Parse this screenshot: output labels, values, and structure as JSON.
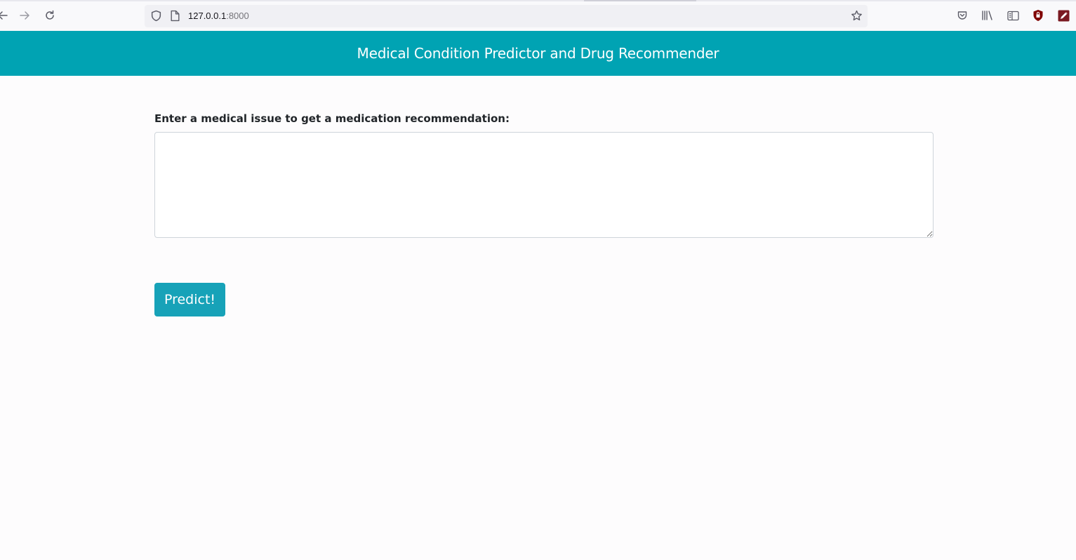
{
  "browser": {
    "url_host": "127.0.0.1",
    "url_port": ":8000",
    "icons": {
      "back": "arrow-left-icon",
      "forward": "arrow-right-icon",
      "reload": "reload-icon",
      "tracking": "shield-icon",
      "page": "page-icon",
      "bookmark": "star-icon",
      "pocket": "pocket-icon",
      "library": "library-icon",
      "sidebar": "sidebar-icon",
      "extension1": "ublock-shield-icon",
      "extension2": "pen-icon"
    }
  },
  "header": {
    "title": "Medical Condition Predictor and Drug Recommender",
    "background_color": "#00a3b3"
  },
  "form": {
    "label": "Enter a medical issue to get a medication recommendation:",
    "textarea_value": "",
    "textarea_placeholder": "",
    "submit_label": "Predict!",
    "button_color": "#17a2b8"
  }
}
